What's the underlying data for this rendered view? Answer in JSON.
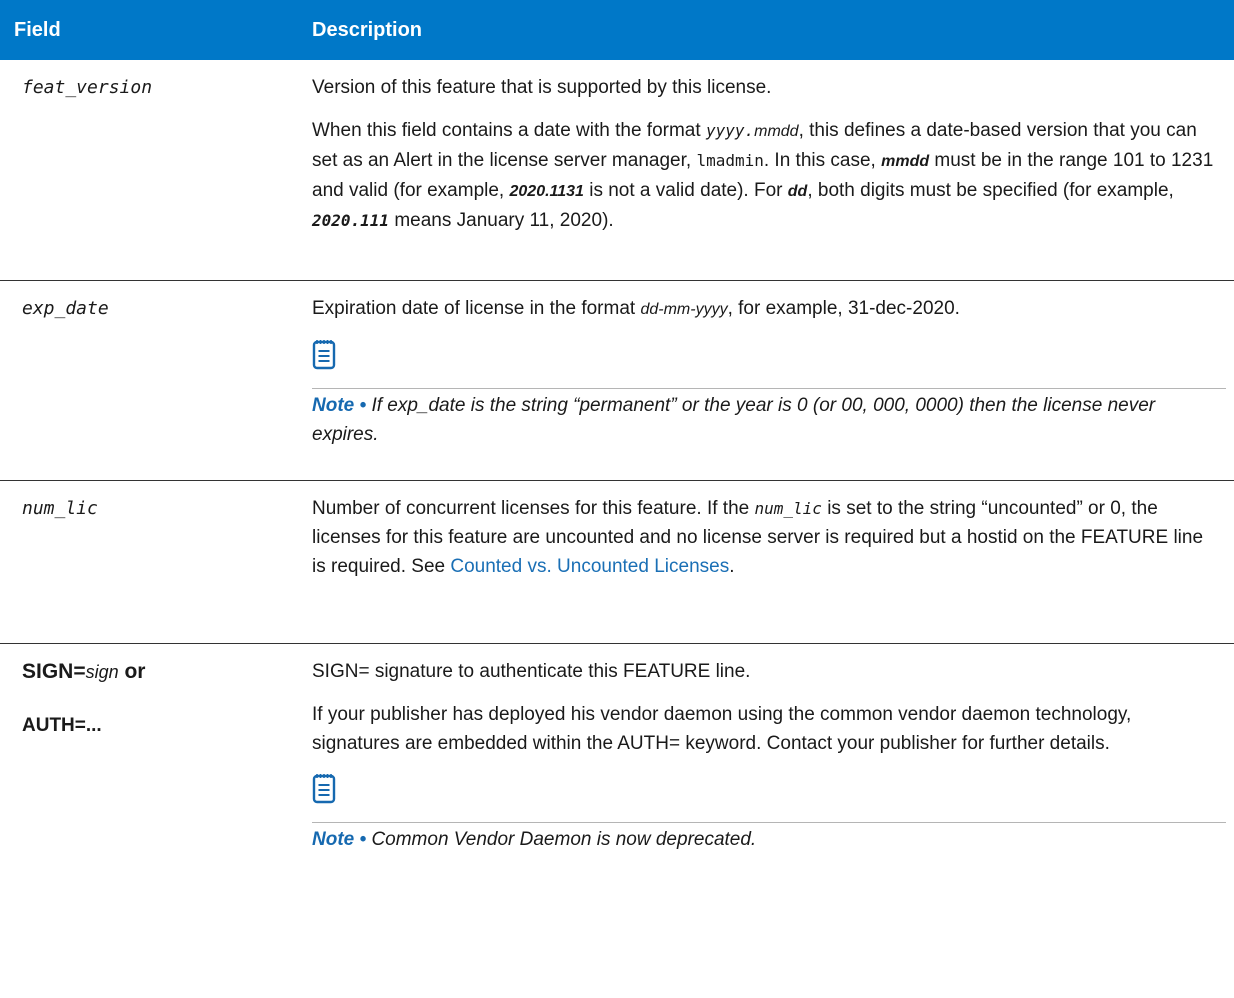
{
  "table": {
    "headers": {
      "field": "Field",
      "description": "Description"
    },
    "rows": {
      "feat_version": {
        "field": "feat_version",
        "desc1": "Version of this feature that is supported by this license.",
        "desc2": {
          "t1": "When this field contains a date with the format ",
          "c1": "yyyy.",
          "c2": "mmdd",
          "t2": ", this defines a date-based version that you can set as an Alert in the license server manager, ",
          "c3": "lmadmin",
          "t3": ". In this case, ",
          "c4": "mmdd",
          "t4": "  must be in the range 101 to 1231 and valid (for example, ",
          "c5": "2020.1131",
          "t5": " is not a valid date). For ",
          "c6": "dd",
          "t6": ", both digits must be specified (for example, ",
          "c7": "2020.111",
          "t7": "  means January 11, 2020)."
        }
      },
      "exp_date": {
        "field": "exp_date",
        "desc1": {
          "t1": "Expiration date of license in the format ",
          "c1": "dd-mm-yyyy",
          "t2": ", for example, 31-dec-2020."
        },
        "note": {
          "icon": "notepad-icon",
          "label": "Note •",
          "text": "If exp_date is the string “permanent” or the year is 0 (or 00, 000, 0000) then the license never expires."
        }
      },
      "num_lic": {
        "field": "num_lic",
        "desc1": {
          "t1": "Number of concurrent licenses for this feature. If the ",
          "c1": "num_lic",
          "t2": " is set to the string “uncounted” or 0, the licenses for this feature are uncounted and no license server is required but a hostid on the FEATURE line is required. See ",
          "link": "Counted vs. Uncounted Licenses",
          "t3": "."
        }
      },
      "sign": {
        "field1": {
          "a": "SIGN=",
          "b": "sign",
          "c": " or"
        },
        "field2": "AUTH=...",
        "desc1": "SIGN= signature to authenticate this FEATURE line.",
        "desc2": "If your publisher has deployed his vendor daemon using the common vendor daemon technology, signatures are embedded within the AUTH= keyword. Contact your publisher for further details.",
        "note": {
          "icon": "notepad-icon",
          "label": "Note •",
          "text": "Common Vendor Daemon is now deprecated."
        }
      }
    }
  },
  "colors": {
    "header_bg": "#0078c8",
    "link": "#1a6fb5",
    "note_label": "#1669b0"
  }
}
